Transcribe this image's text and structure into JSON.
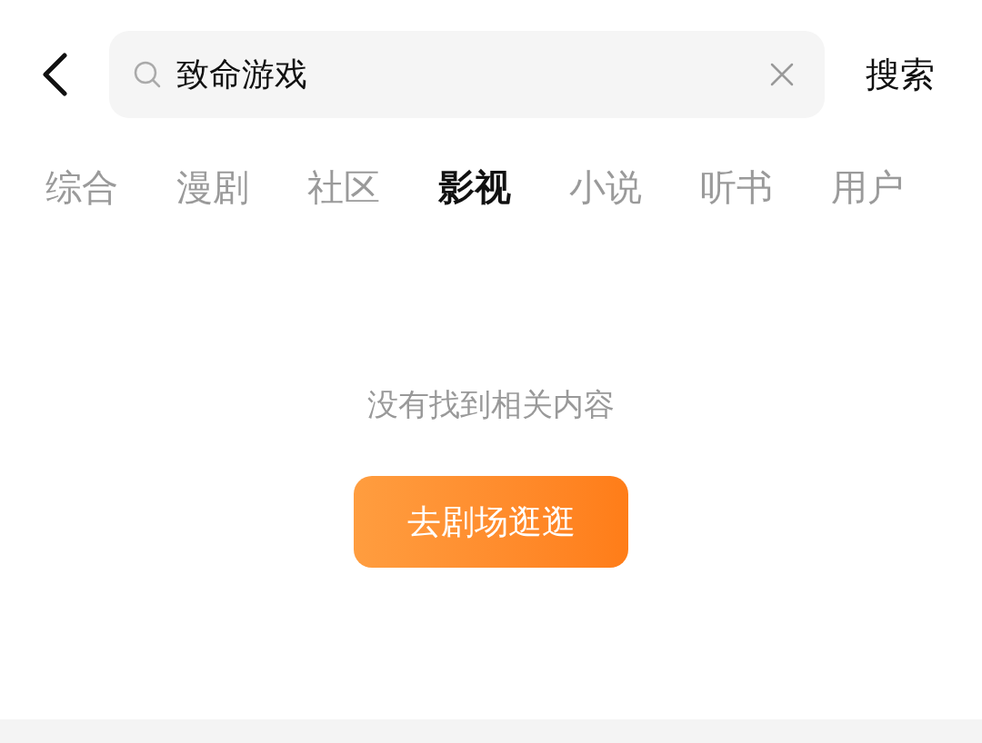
{
  "search": {
    "value": "致命游戏",
    "submit": "搜索"
  },
  "tabs": [
    {
      "label": "综合",
      "selected": false
    },
    {
      "label": "漫剧",
      "selected": false
    },
    {
      "label": "社区",
      "selected": false
    },
    {
      "label": "影视",
      "selected": true
    },
    {
      "label": "小说",
      "selected": false
    },
    {
      "label": "听书",
      "selected": false
    },
    {
      "label": "用户",
      "selected": false
    }
  ],
  "empty_state": {
    "message": "没有找到相关内容",
    "button": "去剧场逛逛"
  }
}
